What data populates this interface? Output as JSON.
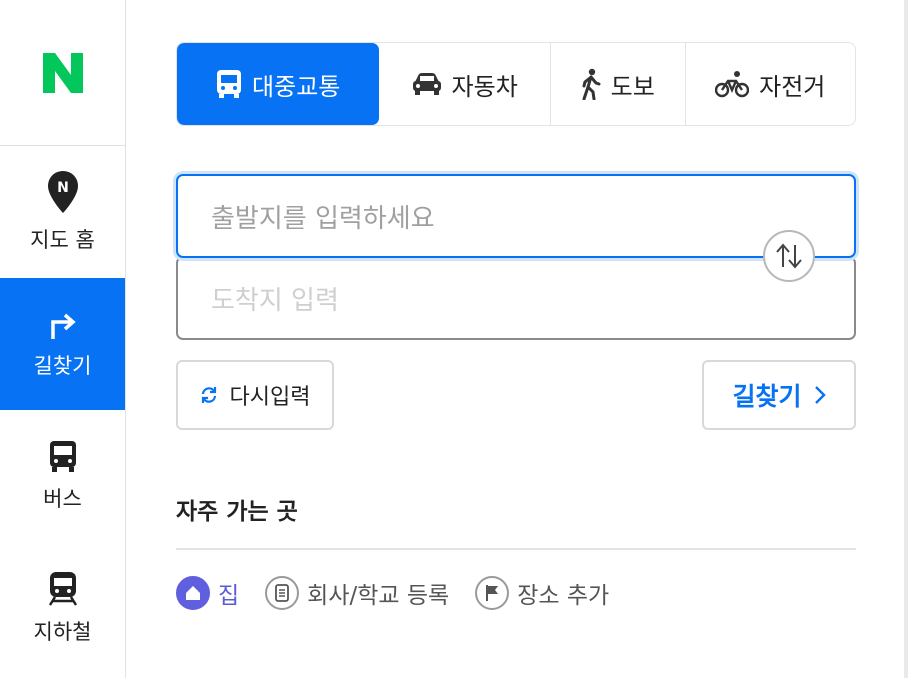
{
  "sidebar": {
    "logo": "N",
    "items": [
      {
        "label": "지도 홈",
        "icon": "map-pin-icon",
        "active": false
      },
      {
        "label": "길찾기",
        "icon": "turn-right-arrow-icon",
        "active": true
      },
      {
        "label": "버스",
        "icon": "bus-icon",
        "active": false
      },
      {
        "label": "지하철",
        "icon": "train-icon",
        "active": false
      }
    ]
  },
  "mode_tabs": [
    {
      "label": "대중교통",
      "icon": "bus-icon",
      "active": true
    },
    {
      "label": "자동차",
      "icon": "car-icon",
      "active": false
    },
    {
      "label": "도보",
      "icon": "walker-icon",
      "active": false
    },
    {
      "label": "자전거",
      "icon": "bicycle-icon",
      "active": false
    }
  ],
  "inputs": {
    "origin_placeholder": "출발지를 입력하세요",
    "destination_placeholder": "도착지 입력"
  },
  "buttons": {
    "reset_label": "다시입력",
    "find_label": "길찾기"
  },
  "favorites": {
    "title": "자주 가는 곳",
    "items": [
      {
        "label": "집",
        "icon": "home-icon"
      },
      {
        "label": "회사/학교 등록",
        "icon": "document-icon"
      },
      {
        "label": "장소 추가",
        "icon": "flag-icon"
      }
    ]
  },
  "colors": {
    "accent": "#0773f4",
    "logo_green": "#03c75a",
    "home_purple": "#5f5fe0"
  }
}
